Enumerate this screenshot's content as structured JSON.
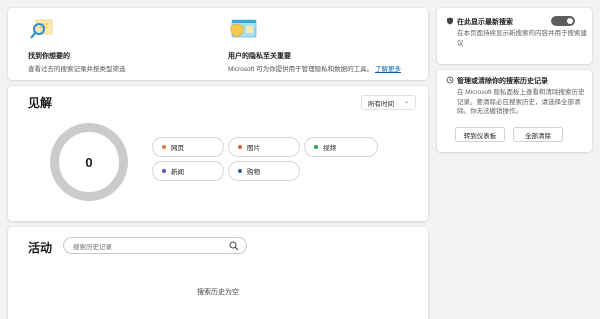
{
  "features": [
    {
      "title": "找到你想要的",
      "description": "查看过去的搜索记录并按类型筛选",
      "icon": "magnifier-illustration-icon"
    },
    {
      "title": "用户的隐私至关重要",
      "description": "Microsoft 可为你提供用于管理隐私和数据的工具。",
      "link": "了解更多",
      "icon": "privacy-illustration-icon"
    }
  ],
  "search_card": {
    "title": "在此显示最新搜索",
    "description": "在本页面持续显示新搜索的内容并用于搜索建议",
    "toggle_state": "off"
  },
  "manage_card": {
    "title": "管理或清除你的搜索历史记录",
    "description": "在 Microsoft 隐私面板上查看和清除搜索历史记录。要清除必应搜索历史，请选择全部清除。你无法撤销操作。",
    "dashboard_button": "转到仪表板",
    "clear_button": "全部清除"
  },
  "insights": {
    "title": "见解",
    "time_filter": "所有时间",
    "total": "0",
    "categories": [
      {
        "label": "网页",
        "color": "#d97b2a"
      },
      {
        "label": "图片",
        "color": "#d9602a"
      },
      {
        "label": "视频",
        "color": "#2f9e5a"
      },
      {
        "label": "新闻",
        "color": "#6b4fbf"
      },
      {
        "label": "购物",
        "color": "#2a5db3"
      }
    ]
  },
  "activity": {
    "title": "活动",
    "search_placeholder": "搜索历史记录",
    "empty_message": "搜索历史为空"
  }
}
